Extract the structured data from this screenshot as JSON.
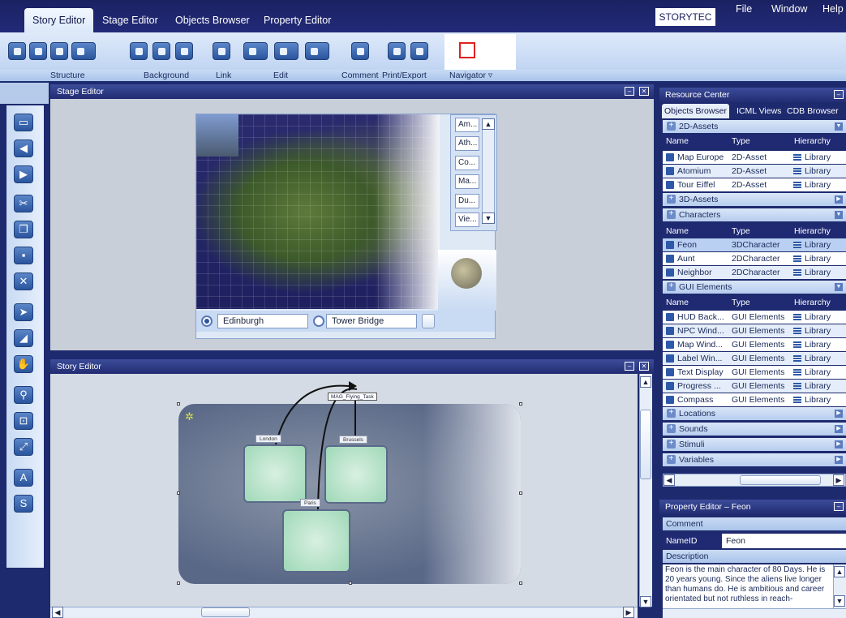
{
  "tabs": [
    "Story Editor",
    "Stage Editor",
    "Objects Browser",
    "Property Editor"
  ],
  "brand": "STORYTEC",
  "menu": [
    "File",
    "Window",
    "Help"
  ],
  "ribbon_groups": [
    "Structure",
    "Background",
    "Link",
    "Edit",
    "Comment",
    "Print/Export",
    "Navigator ▿"
  ],
  "stage_editor": {
    "title": "Stage Editor",
    "list_items": [
      "Am...",
      "Ath...",
      "Co...",
      "Ma...",
      "Du...",
      "Vie..."
    ],
    "location_1": "Edinburgh",
    "location_2": "Tower Bridge"
  },
  "story_editor": {
    "title": "Story Editor",
    "scenes": [
      "London",
      "Brussels",
      "Paris"
    ],
    "task": "MAG_Flying_Task"
  },
  "resource_center": {
    "title": "Resource Center",
    "tabs": [
      "Objects Browser",
      "ICML Views",
      "CDB Browser"
    ],
    "columns": [
      "Name",
      "Type",
      "Hierarchy"
    ],
    "sections": {
      "assets_2d": "2D-Assets",
      "assets_3d": "3D-Assets",
      "characters": "Characters",
      "gui": "GUI Elements",
      "locations": "Locations",
      "sounds": "Sounds",
      "stimuli": "Stimuli",
      "variables": "Variables"
    },
    "assets_2d_rows": [
      {
        "name": "Map Europe",
        "type": "2D-Asset",
        "hier": "Library"
      },
      {
        "name": "Atomium",
        "type": "2D-Asset",
        "hier": "Library"
      },
      {
        "name": "Tour Eiffel",
        "type": "2D-Asset",
        "hier": "Library"
      }
    ],
    "character_rows": [
      {
        "name": "Feon",
        "type": "3DCharacter",
        "hier": "Library"
      },
      {
        "name": "Aunt",
        "type": "2DCharacter",
        "hier": "Library"
      },
      {
        "name": "Neighbor",
        "type": "2DCharacter",
        "hier": "Library"
      }
    ],
    "gui_rows": [
      {
        "name": "HUD Back...",
        "type": "GUI Elements",
        "hier": "Library"
      },
      {
        "name": "NPC Wind...",
        "type": "GUI Elements",
        "hier": "Library"
      },
      {
        "name": "Map Wind...",
        "type": "GUI Elements",
        "hier": "Library"
      },
      {
        "name": "Label Win...",
        "type": "GUI Elements",
        "hier": "Library"
      },
      {
        "name": "Text Display",
        "type": "GUI Elements",
        "hier": "Library"
      },
      {
        "name": "Progress ...",
        "type": "GUI Elements",
        "hier": "Library"
      },
      {
        "name": "Compass",
        "type": "GUI Elements",
        "hier": "Library"
      }
    ]
  },
  "property_editor": {
    "title": "Property Editor – Feon",
    "comment_label": "Comment",
    "nameid_label": "NameID",
    "nameid_value": "Feon",
    "description_label": "Description",
    "description": "Feon is the main character of 80 Days. He is 20 years young. Since the aliens live longer than humans do. He is ambitious and career orientated but not ruthless in reach-"
  },
  "colors": {
    "chrome_dark": "#1e2a6e",
    "ribbon": "#c8dbf5",
    "tool_button": "#2a559e",
    "selection": "#b9d0f2",
    "navigator_marker": "#e02020"
  }
}
